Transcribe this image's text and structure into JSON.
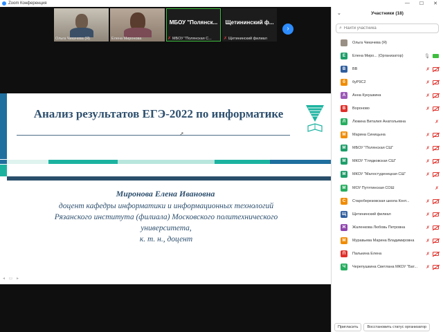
{
  "window": {
    "title": "Zoom Конференция",
    "controls": [
      "—",
      "☐",
      "✕"
    ]
  },
  "thumbnails": [
    {
      "name": "Ольга Чикачева (Я)",
      "type": "video"
    },
    {
      "name": "Елена Миронова",
      "type": "video"
    },
    {
      "name": "МБОУ \"Полянская С...",
      "big_name": "МБОУ \"Полянск...",
      "type": "name",
      "muted": true,
      "active": true
    },
    {
      "name": "Щетининский филиал",
      "big_name": "Щетининский ф...",
      "type": "name",
      "muted": true
    }
  ],
  "slide": {
    "title": "Анализ результатов ЕГЭ-2022 по информатике",
    "author": "Миронова Елена Ивановна",
    "description": [
      "доцент кафедры информатики и информационных технологий",
      "Рязанского института (филиала) Московского политехнического",
      "университета,",
      "к. т. н., доцент"
    ],
    "colors": {
      "primary": "#2d4f6e",
      "accent_teal": "#1bb3a0",
      "accent_blue": "#1f6f9f"
    }
  },
  "participants_panel": {
    "title": "Участники (18)",
    "search_placeholder": "Найти участника",
    "participants": [
      {
        "initial": "",
        "name": "Ольга Чикачева (Я)",
        "color": "#9a8f84",
        "photo": true,
        "mic": "none",
        "cam": "none"
      },
      {
        "initial": "Е",
        "name": "Елена Миро... (Организатор)",
        "color": "#1e9e6a",
        "mic": "on",
        "cam": "on"
      },
      {
        "initial": "В",
        "name": "ВВ",
        "color": "#2f5e9e",
        "mic": "off",
        "cam": "off"
      },
      {
        "initial": "б",
        "name": "буР9С2",
        "color": "#f08c00",
        "mic": "off",
        "cam": "off"
      },
      {
        "initial": "А",
        "name": "Анна Кукушкина",
        "color": "#9b59b6",
        "mic": "off",
        "cam": "off"
      },
      {
        "initial": "В",
        "name": "Вороново",
        "color": "#e0302a",
        "mic": "off",
        "cam": "off"
      },
      {
        "initial": "Л",
        "name": "Люкина Виталия Анатольевна",
        "color": "#27ae60",
        "mic": "off",
        "cam": "none"
      },
      {
        "initial": "М",
        "name": "Марина Синицына",
        "color": "#f08c00",
        "mic": "off",
        "cam": "off"
      },
      {
        "initial": "М",
        "name": "МБОУ \"Полянская СШ\"",
        "color": "#1e9e6a",
        "mic": "off",
        "cam": "off"
      },
      {
        "initial": "М",
        "name": "МКОУ \"Глядковская СШ\"",
        "color": "#1e9e6a",
        "mic": "off",
        "cam": "off"
      },
      {
        "initial": "М",
        "name": "МКОУ \"Малостуденецкая СШ\"",
        "color": "#1e9e6a",
        "mic": "off",
        "cam": "off"
      },
      {
        "initial": "М",
        "name": "МОУ Путятинская СОШ",
        "color": "#27ae60",
        "mic": "off",
        "cam": "none"
      },
      {
        "initial": "С",
        "name": "Староберезовская школа Конт...",
        "color": "#f08c00",
        "mic": "off",
        "cam": "off"
      },
      {
        "initial": "Щ",
        "name": "Щетининский филиал",
        "color": "#2f5e9e",
        "mic": "off",
        "cam": "off"
      },
      {
        "initial": "Ж",
        "name": "Жаленкова Любовь Петровна",
        "color": "#8e44ad",
        "mic": "off",
        "cam": "off"
      },
      {
        "initial": "М",
        "name": "Муравьева Марина Владимировна",
        "color": "#f08c00",
        "mic": "off",
        "cam": "off"
      },
      {
        "initial": "П",
        "name": "Палькина Елена",
        "color": "#e0302a",
        "mic": "off",
        "cam": "off"
      },
      {
        "initial": "Ч",
        "name": "Черепушкина Светлана МКОУ \"Бат...",
        "color": "#27ae60",
        "mic": "off",
        "cam": "off"
      }
    ],
    "footer": {
      "invite": "Пригласить",
      "restore": "Восстановить статус организатор"
    }
  }
}
